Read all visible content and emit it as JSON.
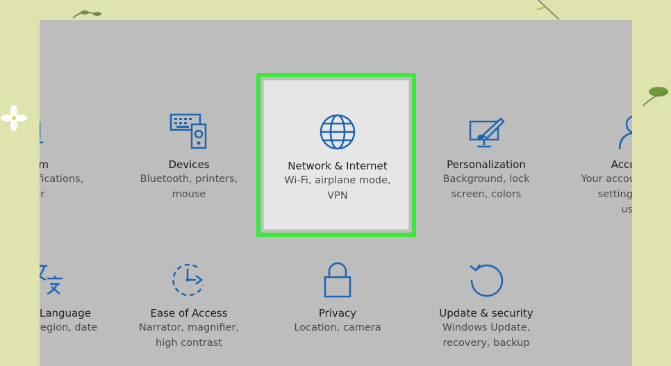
{
  "settings_tiles": [
    {
      "title": "System",
      "desc": [
        "Display, notifications,",
        "power"
      ]
    },
    {
      "title": "Devices",
      "desc": [
        "Bluetooth, printers,",
        "mouse"
      ]
    },
    {
      "title": "Network & Internet",
      "desc": [
        "Wi-Fi, airplane mode,",
        "VPN"
      ]
    },
    {
      "title": "Personalization",
      "desc": [
        "Background, lock",
        "screen, colors"
      ]
    },
    {
      "title": "Accounts",
      "desc": [
        "Your accounts, email,",
        "settings, work,",
        "users"
      ]
    },
    {
      "title": "Time & Language",
      "desc": [
        "Speech, region, date"
      ]
    },
    {
      "title": "Ease of Access",
      "desc": [
        "Narrator, magnifier,",
        "high contrast"
      ]
    },
    {
      "title": "Privacy",
      "desc": [
        "Location, camera"
      ]
    },
    {
      "title": "Update & security",
      "desc": [
        "Windows Update,",
        "recovery, backup"
      ]
    }
  ],
  "icons": {
    "system": "laptop-icon",
    "devices": "keyboard-speaker-icon",
    "network": "globe-icon",
    "personalization": "paint-monitor-icon",
    "accounts": "person-icon",
    "language": "language-icon",
    "ease_of_access": "ease-of-access-icon",
    "privacy": "lock-icon",
    "update": "refresh-icon"
  },
  "colors": {
    "icon_blue": "#1a64b5",
    "highlight": "#3ae83a",
    "panel": "#bdbdbd",
    "background": "#dfe3ad"
  }
}
